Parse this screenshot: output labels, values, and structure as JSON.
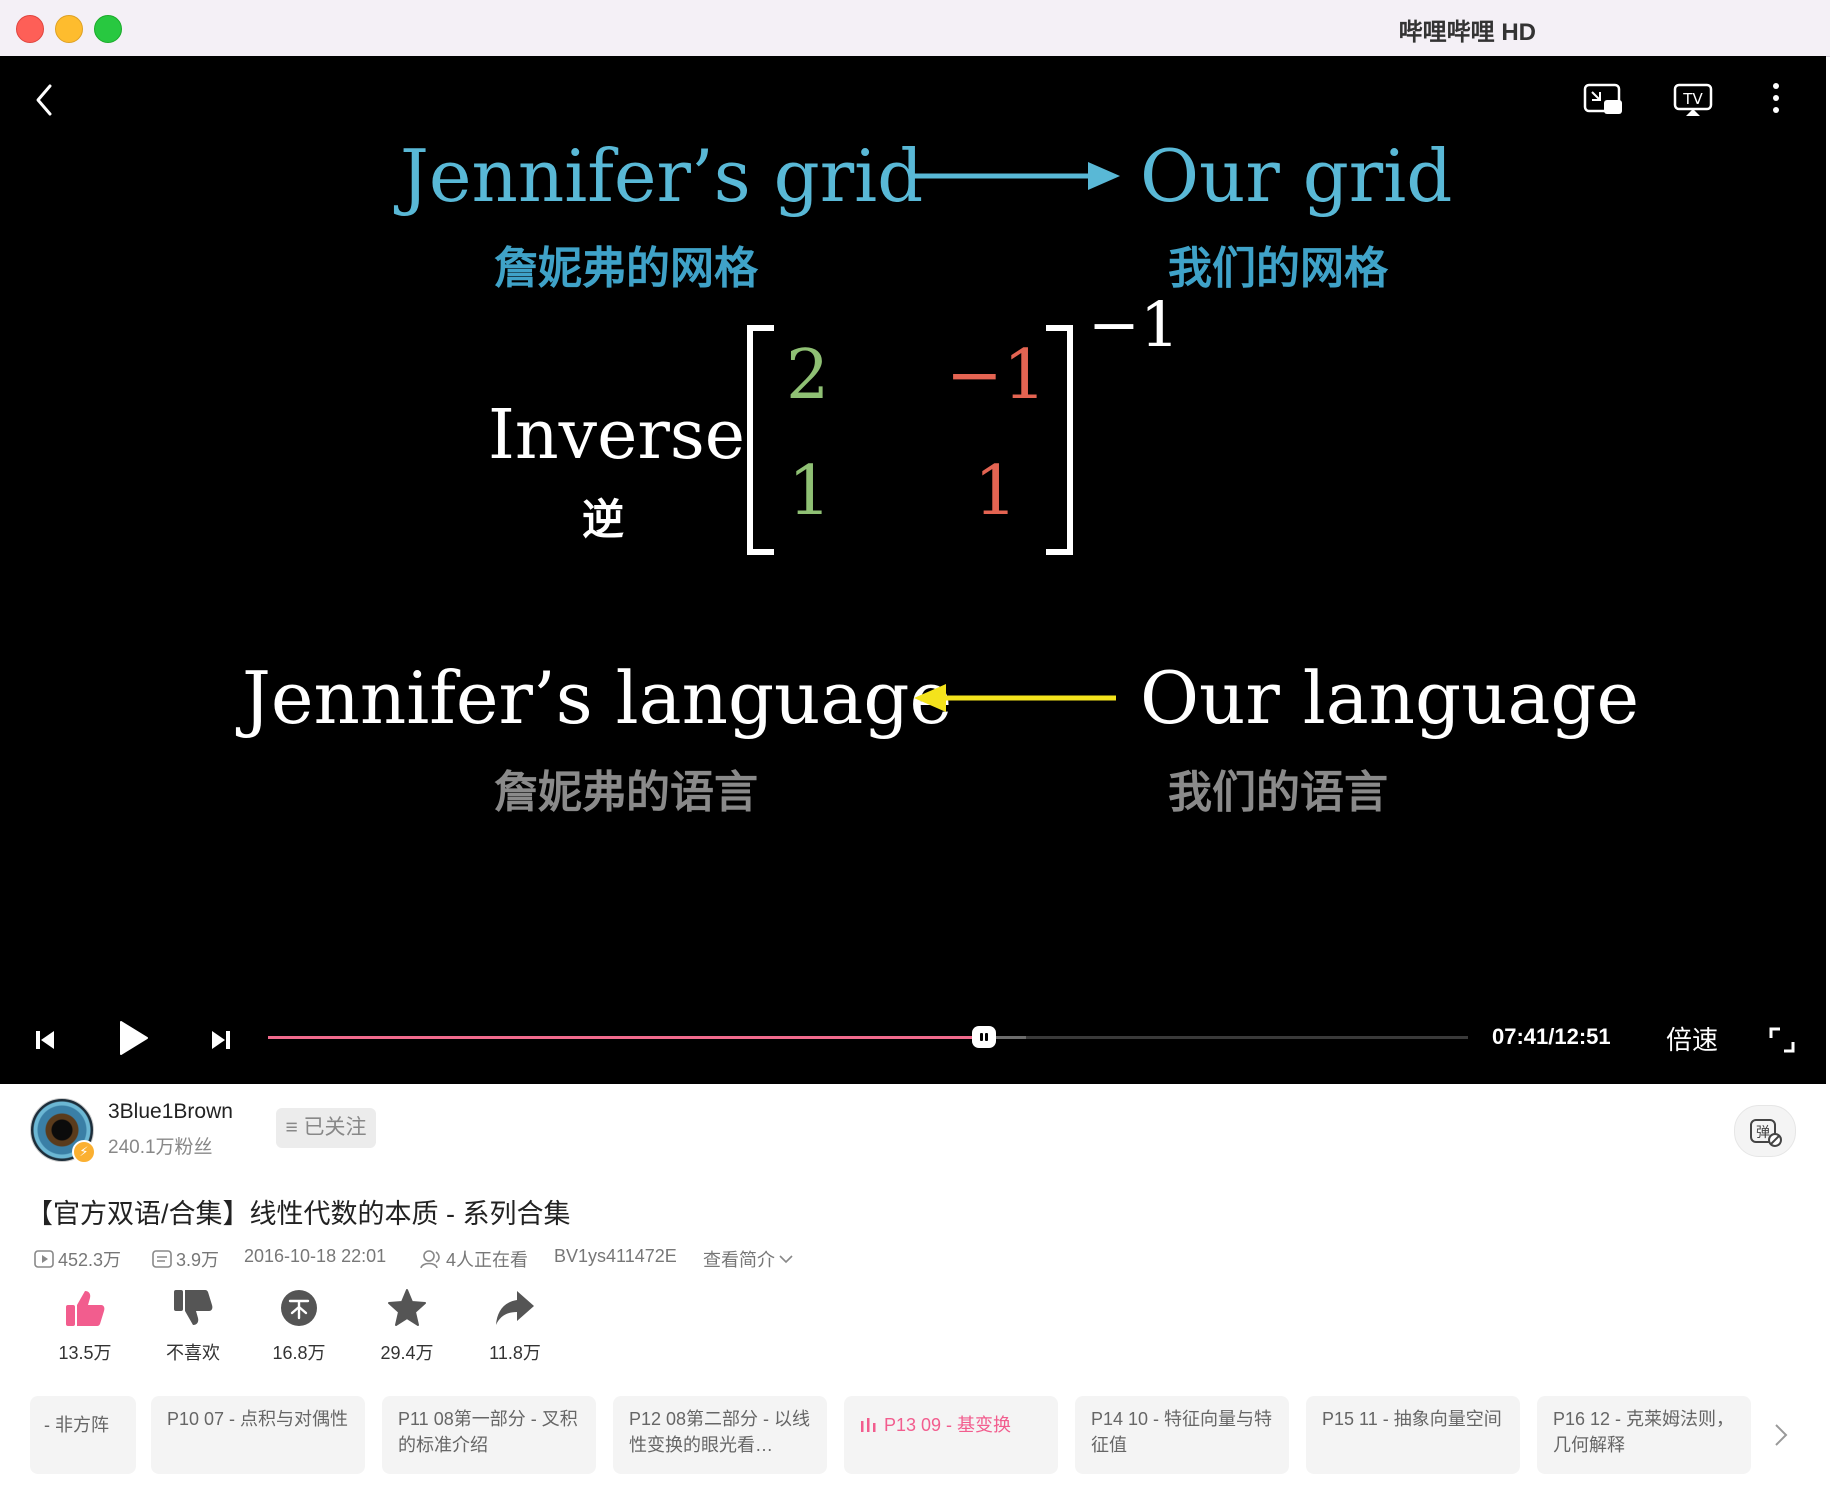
{
  "window": {
    "title": "哔哩哔哩 HD"
  },
  "video": {
    "jennifer_grid": "Jennifer’s grid",
    "jennifer_grid_cn": "詹妮弗的网格",
    "our_grid": "Our grid",
    "our_grid_cn": "我们的网格",
    "inverse": "Inverse",
    "inverse_cn": "逆",
    "matrix": {
      "m11": "2",
      "m12": "−1",
      "m21": "1",
      "m22": "1",
      "exponent": "−1"
    },
    "jennifer_language": "Jennifer’s language",
    "jennifer_language_cn": "詹妮弗的语言",
    "our_language": "Our language",
    "our_language_cn": "我们的语言"
  },
  "player": {
    "time": "07:41/12:51",
    "speed_label": "倍速",
    "progress": 0.597,
    "buffered": 0.632,
    "colors": {
      "progress": "#f06a8c",
      "accent": "#f25d8e"
    }
  },
  "uploader": {
    "name": "3Blue1Brown",
    "fans": "240.1万粉丝",
    "follow_label": "已关注"
  },
  "info": {
    "title": "【官方双语/合集】线性代数的本质 - 系列合集",
    "views": "452.3万",
    "danmaku": "3.9万",
    "date": "2016-10-18 22:01",
    "watching": "4人正在看",
    "bvid": "BV1ys411472E",
    "intro_label": "查看简介"
  },
  "actions": {
    "like": "13.5万",
    "dislike": "不喜欢",
    "coin": "16.8万",
    "favorite": "29.4万",
    "share": "11.8万"
  },
  "episodes": [
    "- 非方阵",
    "P10 07 - 点积与对偶性",
    "P11 08第一部分 - 叉积的标准介绍",
    "P12 08第二部分 - 以线性变换的眼光看…",
    "P13 09 - 基变换",
    "P14 10 - 特征向量与特征值",
    "P15 11 - 抽象向量空间",
    "P16 12 - 克莱姆法则，几何解释"
  ]
}
